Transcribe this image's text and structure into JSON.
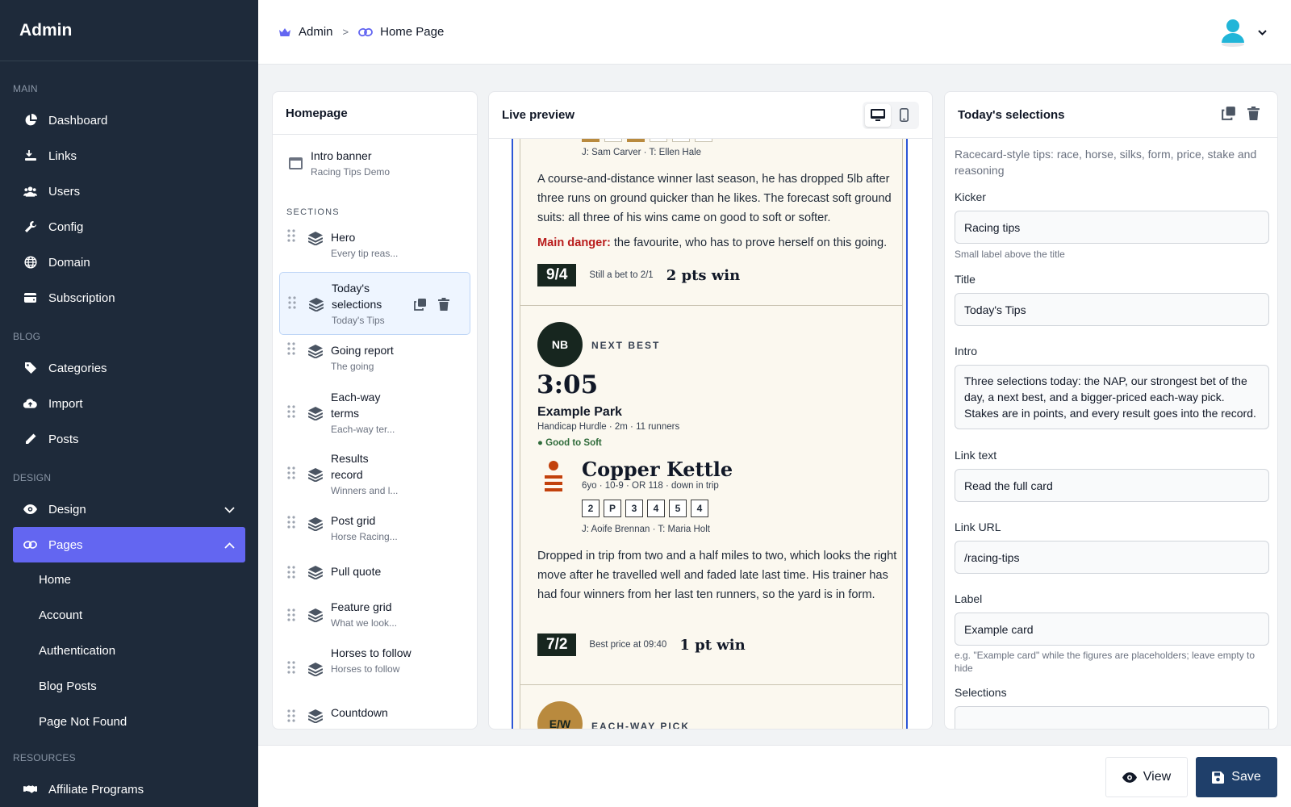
{
  "sidebar": {
    "brand": "Admin",
    "groups": {
      "main": "MAIN",
      "blog": "BLOG",
      "design": "DESIGN",
      "resources": "RESOURCES"
    },
    "main_items": [
      {
        "label": "Dashboard",
        "icon": "chart-pie-icon"
      },
      {
        "label": "Links",
        "icon": "hand-link-icon"
      },
      {
        "label": "Users",
        "icon": "users-icon"
      },
      {
        "label": "Config",
        "icon": "wrench-icon"
      },
      {
        "label": "Domain",
        "icon": "globe-icon"
      },
      {
        "label": "Subscription",
        "icon": "wallet-icon"
      }
    ],
    "blog_items": [
      {
        "label": "Categories",
        "icon": "tag-icon"
      },
      {
        "label": "Import",
        "icon": "cloud-upload-icon"
      },
      {
        "label": "Posts",
        "icon": "pencil-icon"
      }
    ],
    "design_items": [
      {
        "label": "Design",
        "icon": "eye-icon"
      },
      {
        "label": "Pages",
        "icon": "link-icon"
      }
    ],
    "pages_sub": [
      "Home",
      "Account",
      "Authentication",
      "Blog Posts",
      "Page Not Found"
    ],
    "resources_items": [
      {
        "label": "Affiliate Programs",
        "icon": "handshake-icon"
      }
    ],
    "active_color": "#6366f1"
  },
  "topbar": {
    "crumb_root": "Admin",
    "crumb_page": "Home Page",
    "separator": ">"
  },
  "homepage_panel": {
    "title": "Homepage",
    "intro": {
      "title": "Intro banner",
      "sub": "Racing Tips Demo"
    },
    "sections_label": "SECTIONS",
    "sections": [
      {
        "title": "Hero",
        "sub": "Every tip reas..."
      },
      {
        "title": "Today's selections",
        "sub": "Today's Tips"
      },
      {
        "title": "Going report",
        "sub": "The going"
      },
      {
        "title": "Each-way terms",
        "sub": "Each-way ter..."
      },
      {
        "title": "Results record",
        "sub": "Winners and l..."
      },
      {
        "title": "Post grid",
        "sub": "Horse Racing..."
      },
      {
        "title": "Pull quote",
        "sub": ""
      },
      {
        "title": "Feature grid",
        "sub": "What we look..."
      },
      {
        "title": "Horses to follow",
        "sub": "Horses to follow"
      },
      {
        "title": "Countdown",
        "sub": ""
      }
    ]
  },
  "preview": {
    "title": "Live preview",
    "card1": {
      "jockey_trainer": "J: Sam Carver · T: Ellen Hale",
      "para": "A course-and-distance winner last season, he has dropped 5lb after three runs on ground quicker than he likes. The forecast soft ground suits: all three of his wins came on good to soft or softer.",
      "danger_label": "Main danger:",
      "danger_text": "the favourite, who has to prove herself on this going.",
      "price": "9/4",
      "price_note": "Still a bet to 2/1",
      "stake": "2 pts win"
    },
    "card2": {
      "badge": "NB",
      "kicker": "NEXT BEST",
      "time": "3:05",
      "course": "Example Park",
      "race_info": "Handicap Hurdle · 2m · 11 runners",
      "going": "● Good to Soft",
      "horse": "Copper Kettle",
      "horse_info": "6yo · 10-9 · OR 118 · down in trip",
      "form": [
        "2",
        "P",
        "3",
        "4",
        "5",
        "4"
      ],
      "jockey_trainer": "J: Aoife Brennan · T: Maria Holt",
      "para": "Dropped in trip from two and a half miles to two, which looks the right move after he travelled well and faded late last time. His trainer has had four winners from her last ten runners, so the yard is in form.",
      "price": "7/2",
      "price_note": "Best price at 09:40",
      "stake": "1 pt win"
    },
    "card3": {
      "badge": "E/W",
      "kicker": "EACH-WAY PICK"
    },
    "colors": {
      "card_bg": "#fbf8ef",
      "dark_green": "#17261f",
      "gold": "#b98a3e",
      "danger": "#b91c1c"
    }
  },
  "editor": {
    "title": "Today's selections",
    "description": "Racecard-style tips: race, horse, silks, form, price, stake and reasoning",
    "kicker_label": "Kicker",
    "kicker_value": "Racing tips",
    "kicker_hint": "Small label above the title",
    "title_label": "Title",
    "title_value": "Today's Tips",
    "intro_label": "Intro",
    "intro_value": "Three selections today: the NAP, our strongest bet of the day, a next best, and a bigger-priced each-way pick. Stakes are in points, and every result goes into the record.",
    "link_text_label": "Link text",
    "link_text_value": "Read the full card",
    "link_url_label": "Link URL",
    "link_url_value": "/racing-tips",
    "label_label": "Label",
    "label_value": "Example card",
    "label_hint": "e.g. \"Example card\" while the figures are placeholders; leave empty to hide",
    "selections_label": "Selections"
  },
  "actions": {
    "view": "View",
    "save": "Save"
  }
}
